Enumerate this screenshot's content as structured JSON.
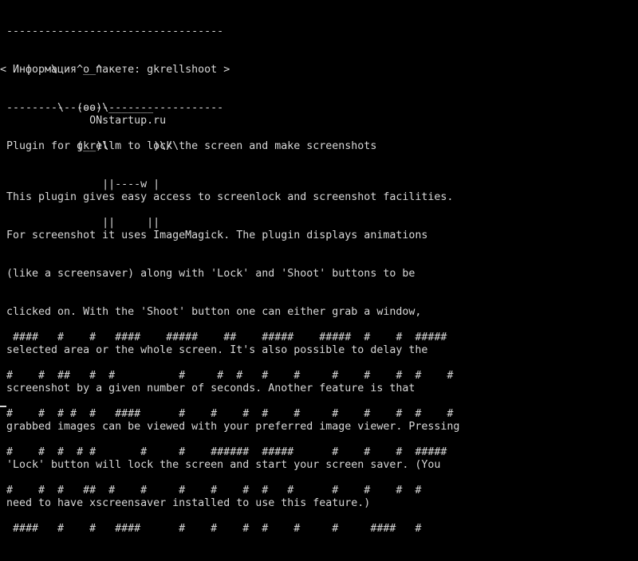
{
  "terminal": {
    "colors": {
      "background": "#000000",
      "text": "#d8d8d8"
    },
    "header": [
      " ----------------------------------",
      "< Информация о пакете: gkrellshoot >",
      " ----------------------------------"
    ],
    "cow": [
      "        \\   ^__^",
      "         \\  (oo)\\_______",
      "            (__)\\       )\\/\\",
      "                ||----w |",
      "                ||     ||"
    ],
    "site": "              ONstartup.ru",
    "summary": " Plugin for gkrellm to lock the screen and make screenshots",
    "description": [
      " This plugin gives easy access to screenlock and screenshot facilities.",
      " For screenshot it uses ImageMagick. The plugin displays animations",
      " (like a screensaver) along with 'Lock' and 'Shoot' buttons to be",
      " clicked on. With the 'Shoot' button one can either grab a window,",
      " selected area or the whole screen. It's also possible to delay the",
      " screenshot by a given number of seconds. Another feature is that",
      " grabbed images can be viewed with your preferred image viewer. Pressing",
      " 'Lock' button will lock the screen and start your screen saver. (You",
      " need to have xscreensaver installed to use this feature.)"
    ],
    "banner": [
      "  ####   #    #   ####    #####    ##    #####    #####  #    #  #####",
      " #    #  ##   #  #          #     #  #   #    #     #    #    #  #    #",
      " #    #  # #  #   ####      #    #    #  #    #     #    #    #  #    #",
      " #    #  #  # #       #     #    ######  #####      #    #    #  #####",
      " #    #  #   ##  #    #     #    #    #  #   #      #    #    #  #",
      "  ####   #    #   ####      #    #    #  #    #     #     ####   #"
    ]
  }
}
